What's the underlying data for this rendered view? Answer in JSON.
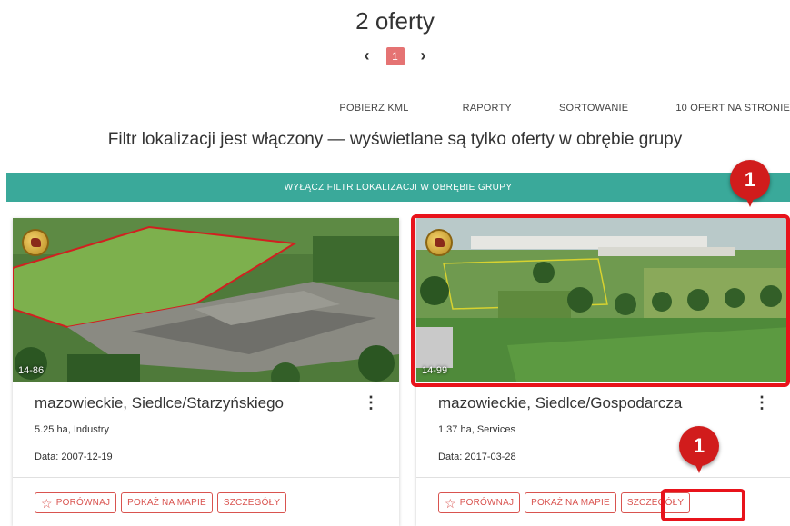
{
  "listing": {
    "count_title": "2 oferty",
    "pagination": {
      "prev_icon": "‹",
      "next_icon": "›",
      "current_page": "1"
    }
  },
  "toolbar": {
    "download_kml": "POBIERZ KML",
    "reports": "RAPORTY",
    "sorting": "SORTOWANIE",
    "per_page": "10 OFERT NA STRONIE"
  },
  "filter": {
    "message": "Filtr lokalizacji jest włączony — wyświetlane są tylko oferty w obrębie grupy",
    "disable_button": "WYŁĄCZ FILTR LOKALIZACJI W OBRĘBIE GRUPY",
    "bar_color": "#3aa99a"
  },
  "offers": [
    {
      "image_id": "14-86",
      "title": "mazowieckie, Siedlce/Starzyńskiego",
      "area": "5.25 ha, Industry",
      "date": "Data: 2007-12-19",
      "compare": "PORÓWNAJ",
      "show_map": "POKAŻ NA MAPIE",
      "details": "SZCZEGÓŁY"
    },
    {
      "image_id": "14-99",
      "title": "mazowieckie, Siedlce/Gospodarcza",
      "area": "1.37 ha, Services",
      "date": "Data: 2017-03-28",
      "compare": "PORÓWNAJ",
      "show_map": "POKAŻ NA MAPIE",
      "details": "SZCZEGÓŁY"
    }
  ],
  "annotations": {
    "marker_1": "1",
    "marker_2": "1",
    "highlight_color": "#e8131b"
  },
  "colors": {
    "accent": "#d9534f",
    "page_active": "#e57373"
  }
}
